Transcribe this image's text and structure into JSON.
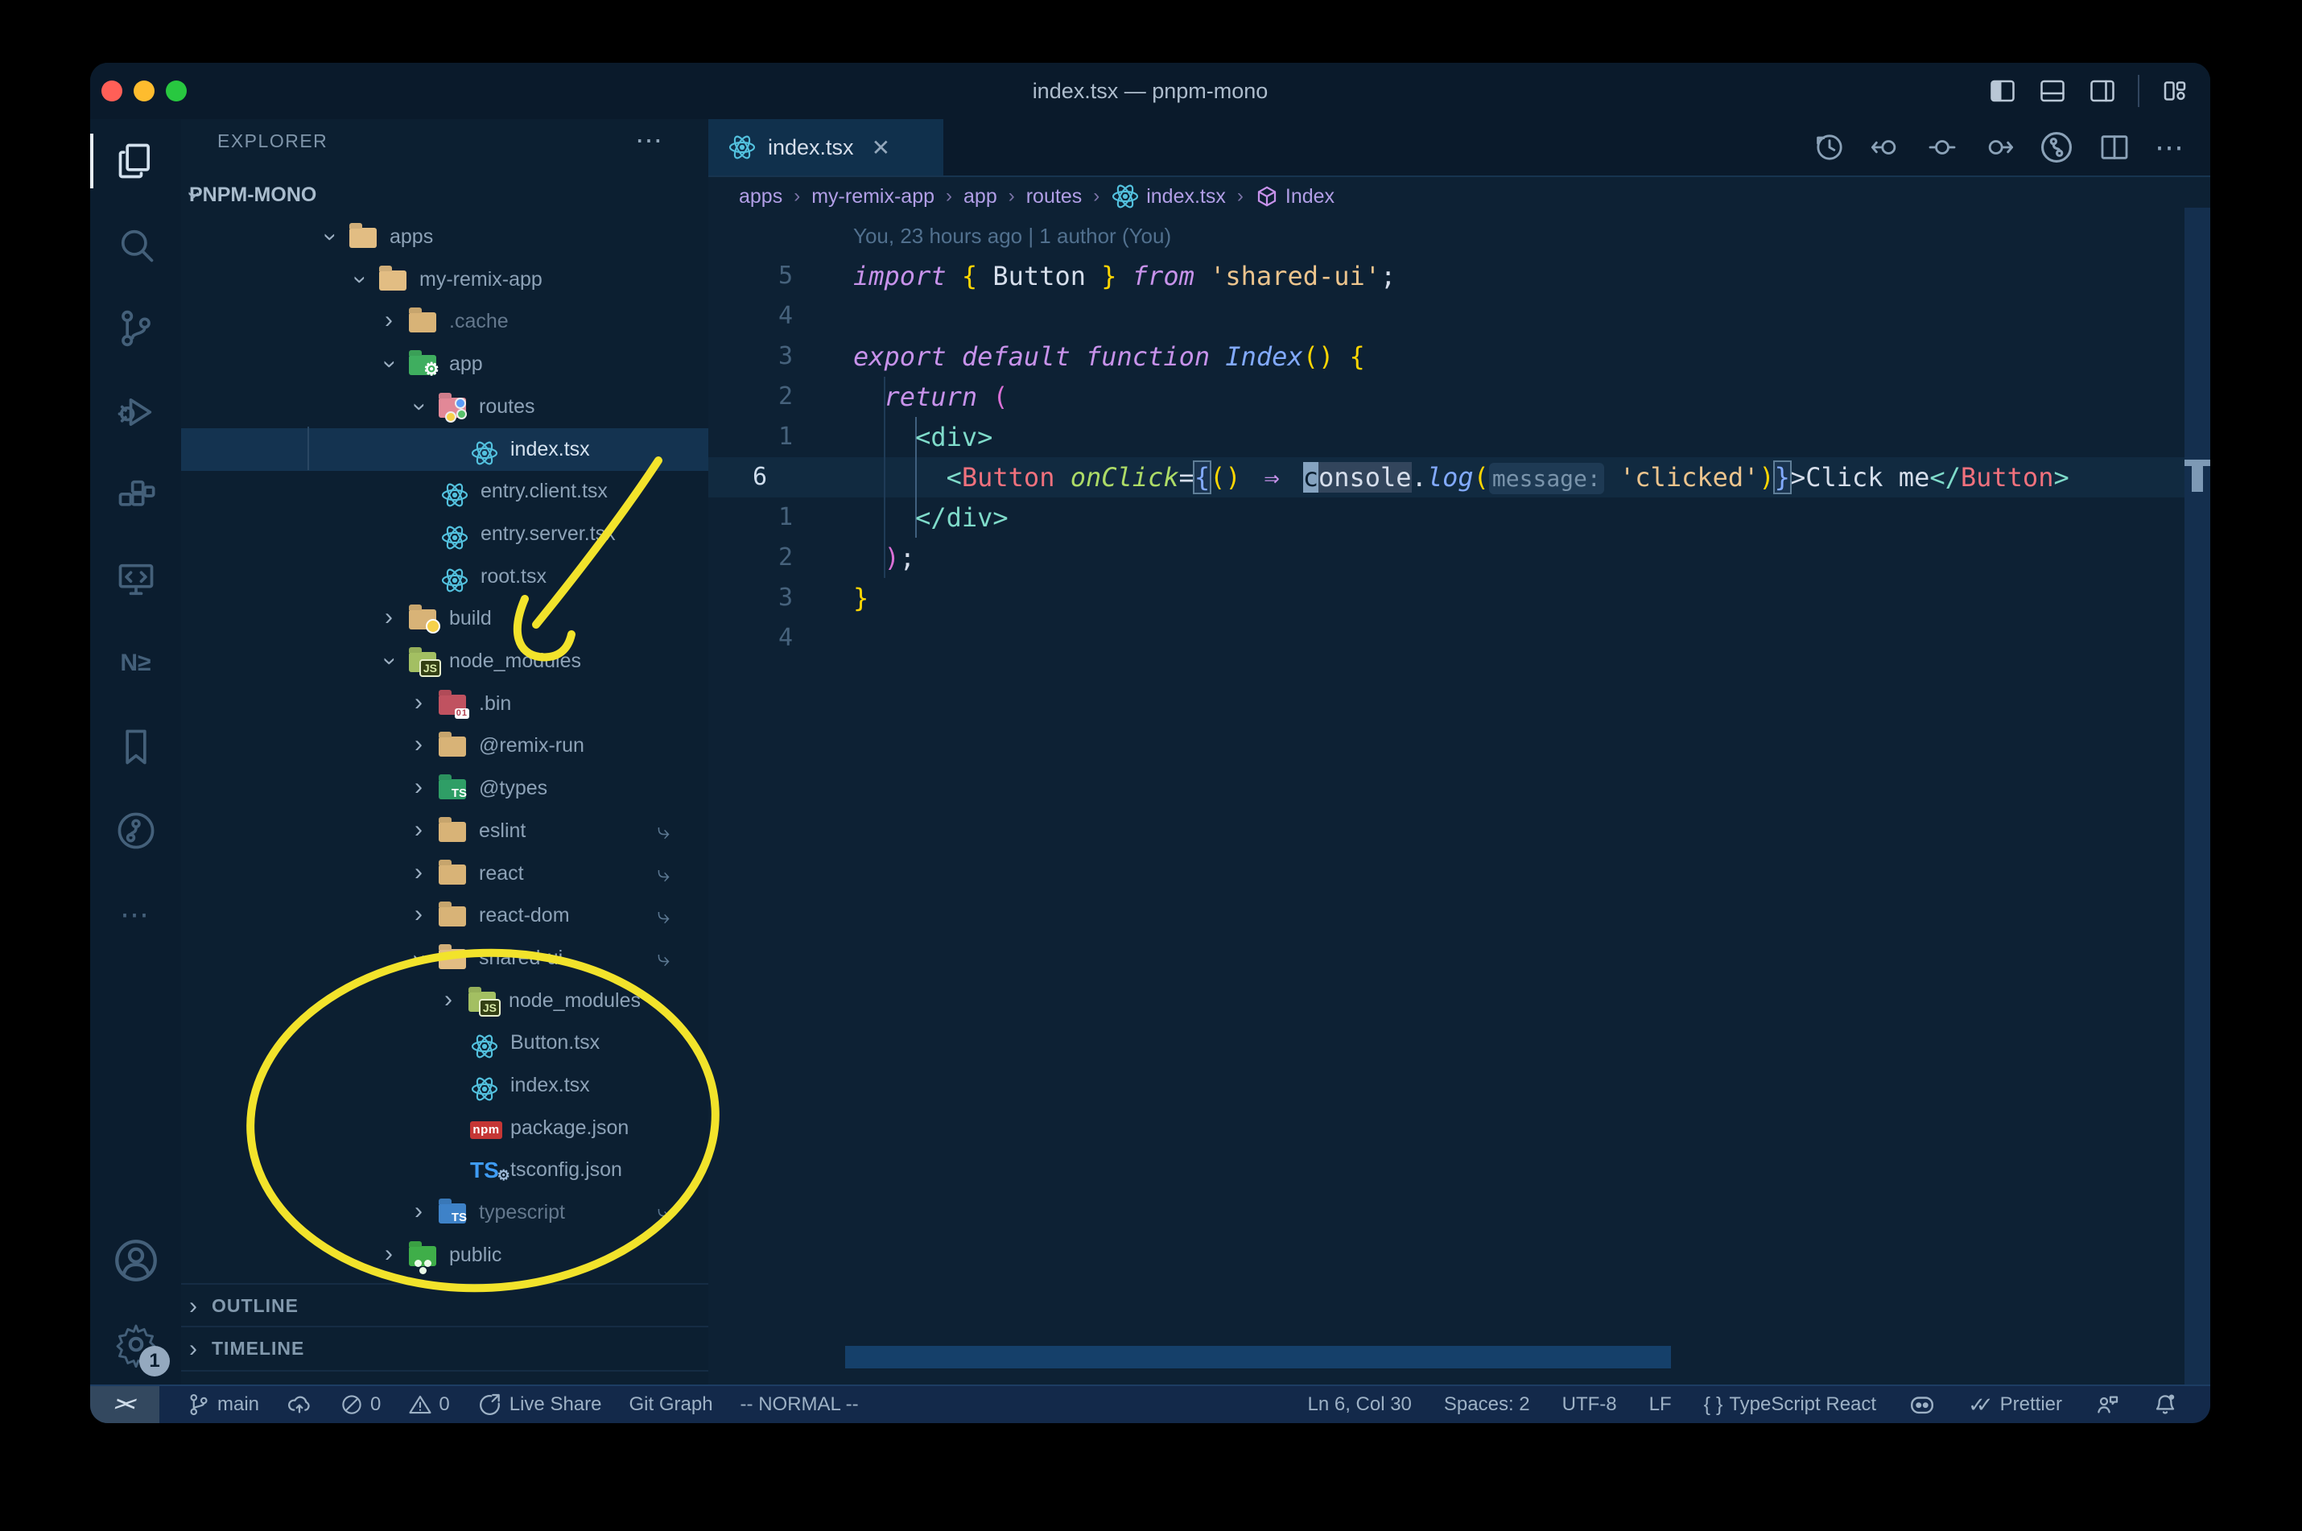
{
  "window": {
    "title": "index.tsx — pnpm-mono"
  },
  "colors": {
    "annotation": "#f2e32b",
    "accent_blue": "#53c1de",
    "status_bg": "#13294a"
  },
  "activity_bar": {
    "items": [
      {
        "name": "explorer",
        "active": true
      },
      {
        "name": "search",
        "active": false
      },
      {
        "name": "source-control",
        "active": false
      },
      {
        "name": "run-debug",
        "active": false
      },
      {
        "name": "extensions",
        "active": false
      },
      {
        "name": "remote-explorer",
        "active": false
      },
      {
        "name": "nx-console",
        "active": false
      },
      {
        "name": "bookmarks",
        "active": false
      },
      {
        "name": "gitlens",
        "active": false
      },
      {
        "name": "more",
        "active": false
      }
    ],
    "bottom": [
      {
        "name": "account"
      },
      {
        "name": "settings",
        "badge": "1"
      }
    ]
  },
  "sidebar": {
    "header": "EXPLORER",
    "root_label": "PNPM-MONO",
    "outline_label": "OUTLINE",
    "timeline_label": "TIMELINE",
    "tree": [
      {
        "label": "apps",
        "depth": 1,
        "kind": "folder",
        "icon": "folder-open",
        "chevron": "open"
      },
      {
        "label": "my-remix-app",
        "depth": 2,
        "kind": "folder",
        "icon": "folder-open",
        "chevron": "open"
      },
      {
        "label": ".cache",
        "depth": 3,
        "kind": "folder",
        "icon": "folder",
        "chevron": "closed",
        "dim": true
      },
      {
        "label": "app",
        "depth": 3,
        "kind": "folder",
        "icon": "folder-app",
        "chevron": "open"
      },
      {
        "label": "routes",
        "depth": 4,
        "kind": "folder",
        "icon": "folder-routes",
        "chevron": "open"
      },
      {
        "label": "index.tsx",
        "depth": 5,
        "kind": "file",
        "icon": "react",
        "selected": true
      },
      {
        "label": "entry.client.tsx",
        "depth": 4,
        "kind": "file",
        "icon": "react"
      },
      {
        "label": "entry.server.tsx",
        "depth": 4,
        "kind": "file",
        "icon": "react"
      },
      {
        "label": "root.tsx",
        "depth": 4,
        "kind": "file",
        "icon": "react"
      },
      {
        "label": "build",
        "depth": 3,
        "kind": "folder",
        "icon": "folder-build",
        "chevron": "closed"
      },
      {
        "label": "node_modules",
        "depth": 3,
        "kind": "folder",
        "icon": "folder-node",
        "chevron": "open"
      },
      {
        "label": ".bin",
        "depth": 4,
        "kind": "folder",
        "icon": "folder-bin",
        "chevron": "closed"
      },
      {
        "label": "@remix-run",
        "depth": 4,
        "kind": "folder",
        "icon": "folder",
        "chevron": "closed"
      },
      {
        "label": "@types",
        "depth": 4,
        "kind": "folder",
        "icon": "folder-types",
        "chevron": "closed"
      },
      {
        "label": "eslint",
        "depth": 4,
        "kind": "folder",
        "icon": "folder",
        "chevron": "closed",
        "symlink": true
      },
      {
        "label": "react",
        "depth": 4,
        "kind": "folder",
        "icon": "folder",
        "chevron": "closed",
        "symlink": true
      },
      {
        "label": "react-dom",
        "depth": 4,
        "kind": "folder",
        "icon": "folder",
        "chevron": "closed",
        "symlink": true
      },
      {
        "label": "shared-ui",
        "depth": 4,
        "kind": "folder",
        "icon": "folder-open",
        "chevron": "open",
        "symlink": true
      },
      {
        "label": "node_modules",
        "depth": 5,
        "kind": "folder",
        "icon": "folder-node",
        "chevron": "closed"
      },
      {
        "label": "Button.tsx",
        "depth": 5,
        "kind": "file",
        "icon": "react"
      },
      {
        "label": "index.tsx",
        "depth": 5,
        "kind": "file",
        "icon": "react"
      },
      {
        "label": "package.json",
        "depth": 5,
        "kind": "file",
        "icon": "npm"
      },
      {
        "label": "tsconfig.json",
        "depth": 5,
        "kind": "file",
        "icon": "tsconfig"
      },
      {
        "label": "typescript",
        "depth": 4,
        "kind": "folder",
        "icon": "folder-ts",
        "chevron": "closed",
        "dim": true,
        "symlink": true
      },
      {
        "label": "public",
        "depth": 3,
        "kind": "folder",
        "icon": "folder-public",
        "chevron": "closed"
      }
    ]
  },
  "tabs": {
    "active_label": "index.tsx",
    "close_glyph": "✕"
  },
  "editor_actions": [
    "history",
    "change-prev",
    "change",
    "change-next",
    "gitlens-graph",
    "split-editor",
    "more"
  ],
  "window_controls": [
    "layout-sidebar-left",
    "layout-panel",
    "layout-sidebar-right",
    "layout-customize"
  ],
  "breadcrumbs": [
    {
      "label": "apps"
    },
    {
      "label": "my-remix-app"
    },
    {
      "label": "app"
    },
    {
      "label": "routes"
    },
    {
      "label": "index.tsx",
      "icon": "react"
    },
    {
      "label": "Index",
      "icon": "symbol-cube"
    }
  ],
  "editor": {
    "blame": "You, 23 hours ago | 1 author (You)",
    "gutter": [
      "5",
      "4",
      "3",
      "2",
      "1",
      "6",
      "1",
      "2",
      "3",
      "4"
    ],
    "current_line_index": 5,
    "lines": [
      [
        [
          "import",
          "kw"
        ],
        [
          " ",
          "w"
        ],
        [
          "{",
          "gold"
        ],
        [
          " ",
          "w"
        ],
        [
          "Button",
          "w"
        ],
        [
          " ",
          "w"
        ],
        [
          "}",
          "gold"
        ],
        [
          " ",
          "w"
        ],
        [
          "from",
          "kw"
        ],
        [
          " ",
          "w"
        ],
        [
          "'shared-ui'",
          "str"
        ],
        [
          ";",
          "w"
        ]
      ],
      [],
      [
        [
          "export",
          "kw"
        ],
        [
          " ",
          "w"
        ],
        [
          "default",
          "kw"
        ],
        [
          " ",
          "w"
        ],
        [
          "function",
          "kw"
        ],
        [
          " ",
          "w"
        ],
        [
          "Index",
          "func"
        ],
        [
          "()",
          "gold"
        ],
        [
          " ",
          "w"
        ],
        [
          "{",
          "gold"
        ]
      ],
      [
        [
          "  ",
          "w"
        ],
        [
          "return",
          "kw"
        ],
        [
          " ",
          "w"
        ],
        [
          "(",
          "orchid"
        ]
      ],
      [
        [
          "    ",
          "w"
        ],
        [
          "<div>",
          "teal"
        ]
      ],
      [
        [
          "      ",
          "w"
        ],
        [
          "<",
          "teal"
        ],
        [
          "Button",
          "comp"
        ],
        [
          " ",
          "w"
        ],
        [
          "onClick",
          "attr"
        ],
        [
          "=",
          "w"
        ],
        [
          "{",
          "bluebox"
        ],
        [
          "()",
          "gold"
        ],
        [
          " ",
          "w"
        ],
        [
          "⇒",
          "arrow"
        ],
        [
          " ",
          "w"
        ],
        [
          "c",
          "cursor"
        ],
        [
          "onsole",
          "whl"
        ],
        [
          ".",
          "w"
        ],
        [
          "log",
          "func"
        ],
        [
          "(",
          "gold"
        ],
        [
          "message:",
          "inlay"
        ],
        [
          " ",
          "w"
        ],
        [
          "'clicked'",
          "str"
        ],
        [
          ")",
          "gold"
        ],
        [
          "}",
          "bluebox"
        ],
        [
          ">",
          "w"
        ],
        [
          "Click me",
          "w"
        ],
        [
          "</",
          "teal"
        ],
        [
          "Button",
          "comp"
        ],
        [
          ">",
          "teal"
        ]
      ],
      [
        [
          "    ",
          "w"
        ],
        [
          "</div>",
          "teal"
        ]
      ],
      [
        [
          "  ",
          "w"
        ],
        [
          ")",
          "orchid"
        ],
        [
          ";",
          "w"
        ]
      ],
      [
        [
          "}",
          "gold"
        ]
      ],
      []
    ]
  },
  "status_bar": {
    "remote_glyph": "><",
    "left": [
      {
        "icon": "branch",
        "label": "main"
      },
      {
        "icon": "cloud-up",
        "label": ""
      },
      {
        "icon": "error",
        "label": "0"
      },
      {
        "icon": "warning",
        "label": "0"
      },
      {
        "icon": "liveshare",
        "label": "Live Share"
      },
      {
        "icon": null,
        "label": "Git Graph"
      },
      {
        "icon": null,
        "label": "-- NORMAL --"
      }
    ],
    "right": [
      {
        "icon": null,
        "label": "Ln 6, Col 30"
      },
      {
        "icon": null,
        "label": "Spaces: 2"
      },
      {
        "icon": null,
        "label": "UTF-8"
      },
      {
        "icon": null,
        "label": "LF"
      },
      {
        "icon": "braces",
        "label": "TypeScript React"
      },
      {
        "icon": "copilot",
        "label": ""
      },
      {
        "icon": "dblcheck",
        "label": "Prettier"
      },
      {
        "icon": "feedback",
        "label": ""
      },
      {
        "icon": "bell",
        "label": ""
      }
    ]
  }
}
